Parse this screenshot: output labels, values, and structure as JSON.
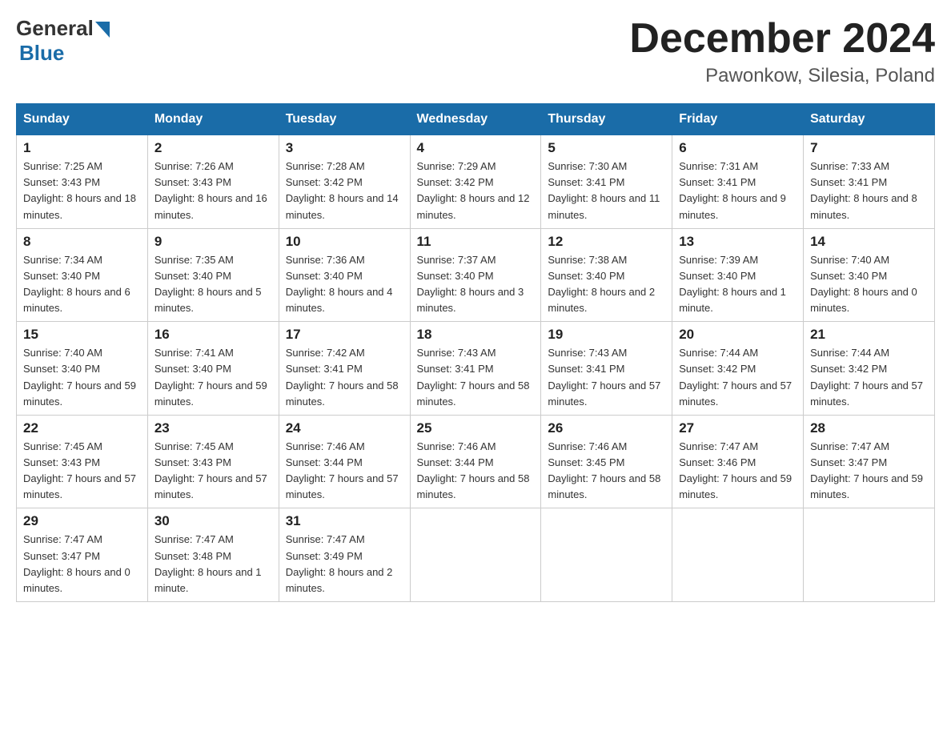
{
  "logo": {
    "general": "General",
    "blue": "Blue"
  },
  "title": {
    "month_year": "December 2024",
    "location": "Pawonkow, Silesia, Poland"
  },
  "days_of_week": [
    "Sunday",
    "Monday",
    "Tuesday",
    "Wednesday",
    "Thursday",
    "Friday",
    "Saturday"
  ],
  "weeks": [
    [
      {
        "day": "1",
        "sunrise": "7:25 AM",
        "sunset": "3:43 PM",
        "daylight": "8 hours and 18 minutes."
      },
      {
        "day": "2",
        "sunrise": "7:26 AM",
        "sunset": "3:43 PM",
        "daylight": "8 hours and 16 minutes."
      },
      {
        "day": "3",
        "sunrise": "7:28 AM",
        "sunset": "3:42 PM",
        "daylight": "8 hours and 14 minutes."
      },
      {
        "day": "4",
        "sunrise": "7:29 AM",
        "sunset": "3:42 PM",
        "daylight": "8 hours and 12 minutes."
      },
      {
        "day": "5",
        "sunrise": "7:30 AM",
        "sunset": "3:41 PM",
        "daylight": "8 hours and 11 minutes."
      },
      {
        "day": "6",
        "sunrise": "7:31 AM",
        "sunset": "3:41 PM",
        "daylight": "8 hours and 9 minutes."
      },
      {
        "day": "7",
        "sunrise": "7:33 AM",
        "sunset": "3:41 PM",
        "daylight": "8 hours and 8 minutes."
      }
    ],
    [
      {
        "day": "8",
        "sunrise": "7:34 AM",
        "sunset": "3:40 PM",
        "daylight": "8 hours and 6 minutes."
      },
      {
        "day": "9",
        "sunrise": "7:35 AM",
        "sunset": "3:40 PM",
        "daylight": "8 hours and 5 minutes."
      },
      {
        "day": "10",
        "sunrise": "7:36 AM",
        "sunset": "3:40 PM",
        "daylight": "8 hours and 4 minutes."
      },
      {
        "day": "11",
        "sunrise": "7:37 AM",
        "sunset": "3:40 PM",
        "daylight": "8 hours and 3 minutes."
      },
      {
        "day": "12",
        "sunrise": "7:38 AM",
        "sunset": "3:40 PM",
        "daylight": "8 hours and 2 minutes."
      },
      {
        "day": "13",
        "sunrise": "7:39 AM",
        "sunset": "3:40 PM",
        "daylight": "8 hours and 1 minute."
      },
      {
        "day": "14",
        "sunrise": "7:40 AM",
        "sunset": "3:40 PM",
        "daylight": "8 hours and 0 minutes."
      }
    ],
    [
      {
        "day": "15",
        "sunrise": "7:40 AM",
        "sunset": "3:40 PM",
        "daylight": "7 hours and 59 minutes."
      },
      {
        "day": "16",
        "sunrise": "7:41 AM",
        "sunset": "3:40 PM",
        "daylight": "7 hours and 59 minutes."
      },
      {
        "day": "17",
        "sunrise": "7:42 AM",
        "sunset": "3:41 PM",
        "daylight": "7 hours and 58 minutes."
      },
      {
        "day": "18",
        "sunrise": "7:43 AM",
        "sunset": "3:41 PM",
        "daylight": "7 hours and 58 minutes."
      },
      {
        "day": "19",
        "sunrise": "7:43 AM",
        "sunset": "3:41 PM",
        "daylight": "7 hours and 57 minutes."
      },
      {
        "day": "20",
        "sunrise": "7:44 AM",
        "sunset": "3:42 PM",
        "daylight": "7 hours and 57 minutes."
      },
      {
        "day": "21",
        "sunrise": "7:44 AM",
        "sunset": "3:42 PM",
        "daylight": "7 hours and 57 minutes."
      }
    ],
    [
      {
        "day": "22",
        "sunrise": "7:45 AM",
        "sunset": "3:43 PM",
        "daylight": "7 hours and 57 minutes."
      },
      {
        "day": "23",
        "sunrise": "7:45 AM",
        "sunset": "3:43 PM",
        "daylight": "7 hours and 57 minutes."
      },
      {
        "day": "24",
        "sunrise": "7:46 AM",
        "sunset": "3:44 PM",
        "daylight": "7 hours and 57 minutes."
      },
      {
        "day": "25",
        "sunrise": "7:46 AM",
        "sunset": "3:44 PM",
        "daylight": "7 hours and 58 minutes."
      },
      {
        "day": "26",
        "sunrise": "7:46 AM",
        "sunset": "3:45 PM",
        "daylight": "7 hours and 58 minutes."
      },
      {
        "day": "27",
        "sunrise": "7:47 AM",
        "sunset": "3:46 PM",
        "daylight": "7 hours and 59 minutes."
      },
      {
        "day": "28",
        "sunrise": "7:47 AM",
        "sunset": "3:47 PM",
        "daylight": "7 hours and 59 minutes."
      }
    ],
    [
      {
        "day": "29",
        "sunrise": "7:47 AM",
        "sunset": "3:47 PM",
        "daylight": "8 hours and 0 minutes."
      },
      {
        "day": "30",
        "sunrise": "7:47 AM",
        "sunset": "3:48 PM",
        "daylight": "8 hours and 1 minute."
      },
      {
        "day": "31",
        "sunrise": "7:47 AM",
        "sunset": "3:49 PM",
        "daylight": "8 hours and 2 minutes."
      },
      null,
      null,
      null,
      null
    ]
  ]
}
